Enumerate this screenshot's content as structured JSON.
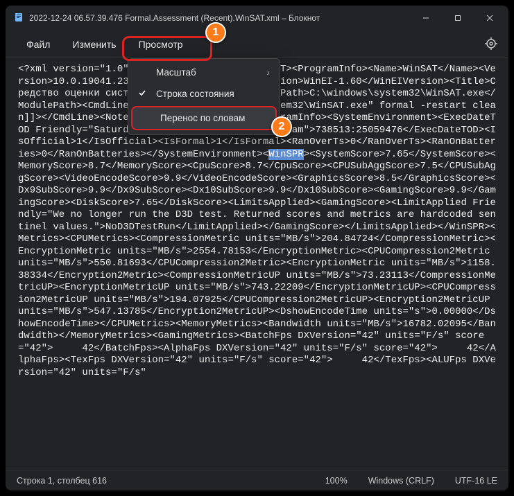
{
  "window": {
    "title": "2022-12-24 06.57.39.476 Formal.Assessment (Recent).WinSAT.xml – Блокнот"
  },
  "menu": {
    "file": "Файл",
    "edit": "Изменить",
    "view": "Просмотр"
  },
  "dropdown": {
    "zoom": "Масштаб",
    "statusbar": "Строка состояния",
    "wordwrap": "Перенос по словам"
  },
  "badges": {
    "b1": "1",
    "b2": "2"
  },
  "status": {
    "pos": "Строка 1, столбец 616",
    "zoom": "100%",
    "eol": "Windows (CRLF)",
    "enc": "UTF-16 LE"
  },
  "highlight": "WinSPR",
  "text_pre": "<?xml version=\"1.0\" encoding=\"UTF-16\"?><WinSAT><ProgramInfo><Name>WinSAT</Name><Version>10.0.19041.2300.653</Version><WinEIVersion>WinEI-1.60</WinEIVersion><Title>Средство оценки системы Windows</Title><ModulePath>C:\\windows\\system32\\WinSAT.exe</ModulePath><CmdLine><![CDATA[\"C:\\windows\\system32\\WinSAT.exe\" formal -restart clean]]></CmdLine><Note><![CDATA[]]></Note></ProgramInfo><SystemEnvironment><ExecDateTOD Friendly=\"Saturday December 24, 2022 6:57:39am\">738513:25059476</ExecDateTOD><IsOfficial>1</IsOfficial><IsFormal>1</IsFormal><RanOverTs>0</RanOverTs><RanOnBatteries>0</RanOnBatteries></SystemEnvironment><",
  "text_post": "><SystemScore>7.65</SystemScore><MemoryScore>8.7</MemoryScore><CpuScore>8.7</CpuScore><CPUSubAggScore>7.5</CPUSubAggScore><VideoEncodeScore>9.9</VideoEncodeScore><GraphicsScore>8.5</GraphicsScore><Dx9SubScore>9.9</Dx9SubScore><Dx10SubScore>9.9</Dx10SubScore><GamingScore>9.9</GamingScore><DiskScore>7.65</DiskScore><LimitsApplied><GamingScore><LimitApplied Friendly=\"We no longer run the D3D test. Returned scores and metrics are hardcoded sentinel values.\">NoD3DTestRun</LimitApplied></GamingScore></LimitsApplied></WinSPR><Metrics><CPUMetrics><CompressionMetric units=\"MB/s\">204.84724</CompressionMetric><EncryptionMetric units=\"MB/s\">2554.78153</EncryptionMetric><CPUCompression2Metric units=\"MB/s\">550.81693</CPUCompression2Metric><EncryptionMetric units=\"MB/s\">1158.38334</Encryption2Metric><CompressionMetricUP units=\"MB/s\">73.23113</CompressionMetricUP><EncryptionMetricUP units=\"MB/s\">743.22209</EncryptionMetricUP><CPUCompression2MetricUP units=\"MB/s\">194.07925</CPUCompression2MetricUP><Encryption2MetricUP units=\"MB/s\">547.13785</Encryption2MetricUP><DshowEncodeTime units=\"s\">0.00000</DshowEncodeTime></CPUMetrics><MemoryMetrics><Bandwidth units=\"MB/s\">16782.02095</Bandwidth></MemoryMetrics><GamingMetrics><BatchFps DXVersion=\"42\" units=\"F/s\" score=\"42\">     42</BatchFps><AlphaFps DXVersion=\"42\" units=\"F/s\" score=\"42\">     42</AlphaFps><TexFps DXVersion=\"42\" units=\"F/s\" score=\"42\">     42</TexFps><ALUFps DXVersion=\"42\" units=\"F/s\""
}
